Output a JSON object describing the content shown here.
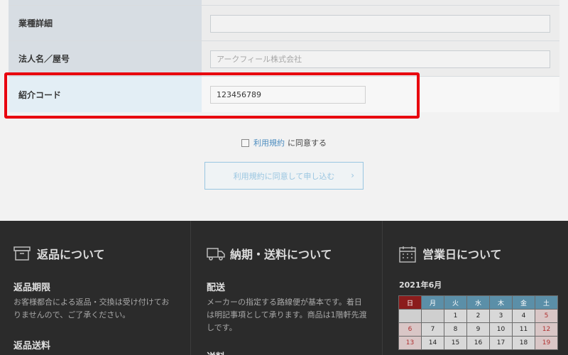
{
  "form": {
    "rows": [
      {
        "label": "業種詳細",
        "value": "",
        "placeholder": ""
      },
      {
        "label": "法人名／屋号",
        "value": "",
        "placeholder": "アークフィール株式会社"
      },
      {
        "label": "紹介コード",
        "value": "123456789",
        "placeholder": ""
      }
    ],
    "agree": {
      "link_label": "利用規約",
      "rest_label": "に同意する"
    },
    "submit_label": "利用規約に同意して申し込む",
    "highlight_color": "#e8000e"
  },
  "footer": {
    "returns": {
      "title": "返品について",
      "period_title": "返品期限",
      "period_text": "お客様都合による返品・交換は受け付けておりませんので、ご了承ください。",
      "shipping_title": "返品送料"
    },
    "delivery": {
      "title": "納期・送料について",
      "delivery_title": "配送",
      "delivery_text": "メーカーの指定する路線便が基本です。着日は明記事項として承ります。商品は1階軒先渡しです。",
      "shipping_title": "送料"
    },
    "business": {
      "title": "営業日について",
      "month": "2021年6月",
      "weekdays": [
        "日",
        "月",
        "火",
        "水",
        "木",
        "金",
        "土"
      ],
      "weeks": [
        [
          "",
          "",
          "1",
          "2",
          "3",
          "4",
          "5"
        ],
        [
          "6",
          "7",
          "8",
          "9",
          "10",
          "11",
          "12"
        ],
        [
          "13",
          "14",
          "15",
          "16",
          "17",
          "18",
          "19"
        ]
      ]
    }
  }
}
